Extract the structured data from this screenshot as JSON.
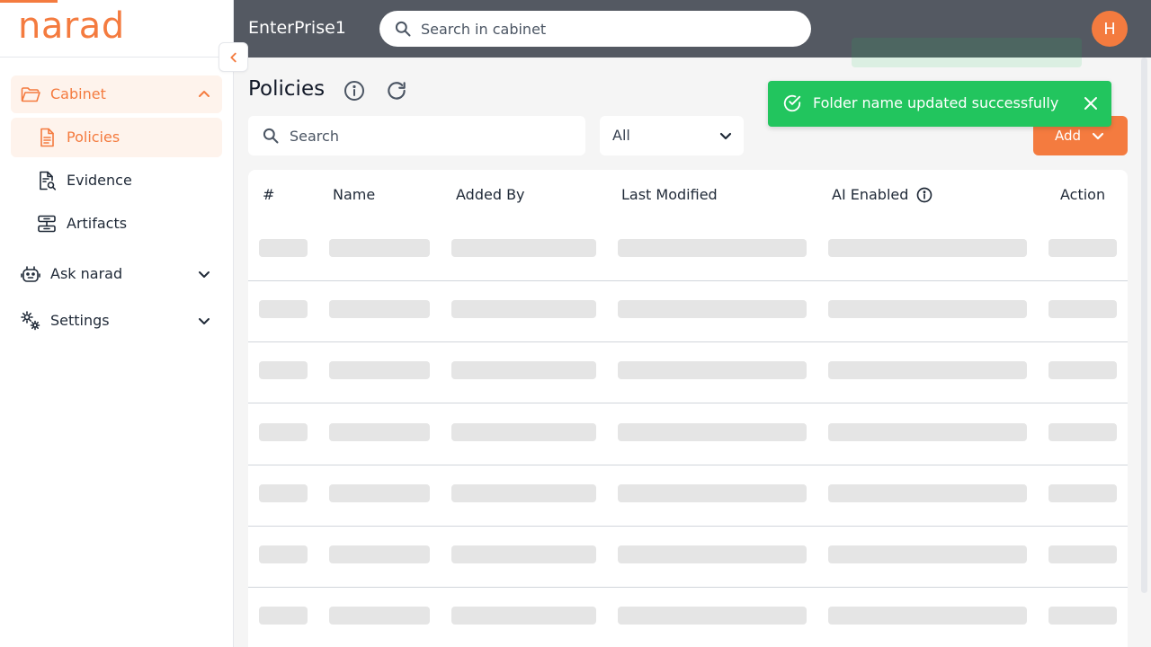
{
  "app": {
    "logo_text": "narad",
    "org_name": "EnterPrise1",
    "avatar_initial": "H",
    "accent_color": "#f47b3f",
    "header_color": "#545962"
  },
  "search": {
    "placeholder": "Search in cabinet"
  },
  "sidebar": {
    "cabinet": {
      "label": "Cabinet",
      "icon": "folder-icon",
      "expanded": true
    },
    "items": [
      {
        "label": "Policies",
        "icon": "document-icon",
        "active": true
      },
      {
        "label": "Evidence",
        "icon": "document-search-icon",
        "active": false
      },
      {
        "label": "Artifacts",
        "icon": "artifact-icon",
        "active": false
      }
    ],
    "ask": {
      "label": "Ask narad",
      "icon": "robot-icon"
    },
    "settings": {
      "label": "Settings",
      "icon": "gears-icon"
    }
  },
  "page": {
    "title": "Policies",
    "table_search_placeholder": "Search",
    "filter_value": "All",
    "add_label": "Add"
  },
  "toast": {
    "message": "Folder name updated successfully",
    "color": "#22c55e"
  },
  "table": {
    "columns": [
      "#",
      "Name",
      "Added By",
      "Last Modified",
      "AI Enabled",
      "Action"
    ],
    "loading_rows": 7
  }
}
